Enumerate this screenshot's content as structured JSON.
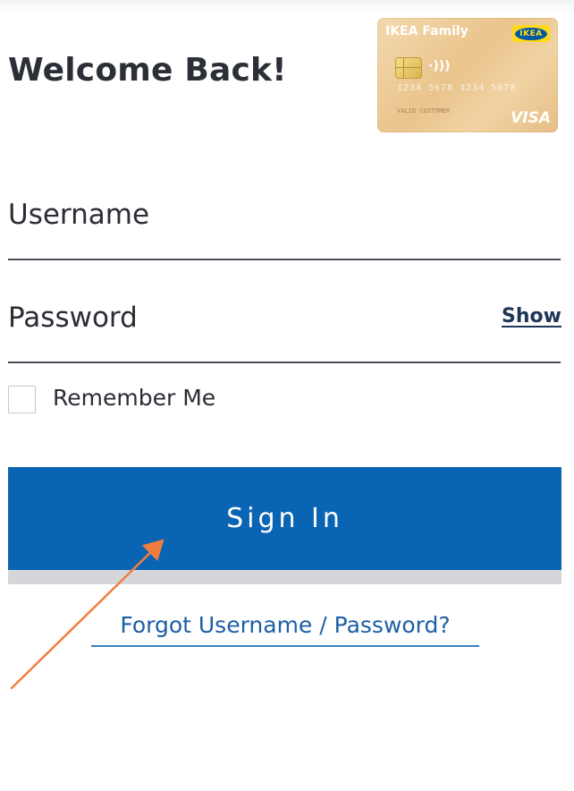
{
  "header": {
    "title": "Welcome Back!"
  },
  "card": {
    "brand": "IKEA Family",
    "logo_text": "IKEA",
    "contactless_symbol": "·)))",
    "number": "1234  5678  1234  5678",
    "holder": "VALID  CUSTOMER",
    "network": "VISA"
  },
  "form": {
    "username_label": "Username",
    "password_label": "Password",
    "show_label": "Show",
    "remember_label": "Remember Me",
    "remember_checked": false,
    "signin_label": "Sign In",
    "forgot_label": "Forgot Username / Password?"
  },
  "colors": {
    "primary_button": "#0a64b4",
    "link": "#1c5fa6",
    "annotation_arrow": "#f07d3f"
  },
  "icons": {
    "checkbox": "checkbox-icon",
    "annotation": "arrow-pointer-icon"
  }
}
